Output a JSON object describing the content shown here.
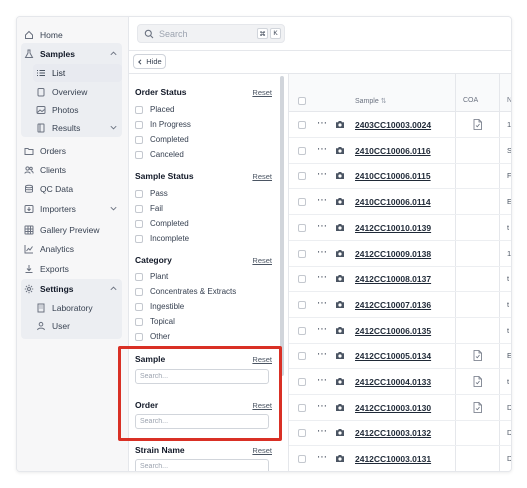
{
  "sidebar": {
    "items": [
      {
        "label": "Home",
        "icon": "home-icon"
      },
      {
        "label": "Samples",
        "icon": "flask-icon"
      },
      {
        "label": "List",
        "icon": "list-icon"
      },
      {
        "label": "Overview",
        "icon": "clipboard-icon"
      },
      {
        "label": "Photos",
        "icon": "image-icon"
      },
      {
        "label": "Results",
        "icon": "document-icon"
      },
      {
        "label": "Orders",
        "icon": "folder-icon"
      },
      {
        "label": "Clients",
        "icon": "users-icon"
      },
      {
        "label": "QC Data",
        "icon": "database-icon"
      },
      {
        "label": "Importers",
        "icon": "import-icon"
      },
      {
        "label": "Gallery Preview",
        "icon": "gallery-icon"
      },
      {
        "label": "Analytics",
        "icon": "chart-icon"
      },
      {
        "label": "Exports",
        "icon": "download-icon"
      },
      {
        "label": "Settings",
        "icon": "gear-icon"
      },
      {
        "label": "Laboratory",
        "icon": "building-icon"
      },
      {
        "label": "User",
        "icon": "user-icon"
      }
    ]
  },
  "search": {
    "placeholder": "Search",
    "shortcut_mod": "⌘",
    "shortcut_key": "K"
  },
  "hide_button": {
    "label": "Hide"
  },
  "filters": {
    "reset_label": "Reset",
    "order_status": {
      "title": "Order Status",
      "options": [
        "Placed",
        "In Progress",
        "Completed",
        "Canceled"
      ]
    },
    "sample_status": {
      "title": "Sample Status",
      "options": [
        "Pass",
        "Fail",
        "Completed",
        "Incomplete"
      ]
    },
    "category": {
      "title": "Category",
      "options": [
        "Plant",
        "Concentrates & Extracts",
        "Ingestible",
        "Topical",
        "Other"
      ]
    },
    "sample": {
      "title": "Sample",
      "placeholder": "Search..."
    },
    "order": {
      "title": "Order",
      "placeholder": "Search..."
    },
    "strain_name": {
      "title": "Strain Name",
      "placeholder": "Search..."
    }
  },
  "table": {
    "headers": {
      "sample": "Sample",
      "coa": "COA",
      "next": "N"
    },
    "rows": [
      {
        "sample": "2403CC10003.0024",
        "coa": true,
        "trunc": "1"
      },
      {
        "sample": "2410CC10006.0116",
        "coa": false,
        "trunc": "S"
      },
      {
        "sample": "2410CC10006.0115",
        "coa": false,
        "trunc": "F"
      },
      {
        "sample": "2410CC10006.0114",
        "coa": false,
        "trunc": "E"
      },
      {
        "sample": "2412CC10010.0139",
        "coa": false,
        "trunc": "t"
      },
      {
        "sample": "2412CC10009.0138",
        "coa": false,
        "trunc": "1"
      },
      {
        "sample": "2412CC10008.0137",
        "coa": false,
        "trunc": "t"
      },
      {
        "sample": "2412CC10007.0136",
        "coa": false,
        "trunc": "t"
      },
      {
        "sample": "2412CC10006.0135",
        "coa": false,
        "trunc": "t"
      },
      {
        "sample": "2412CC10005.0134",
        "coa": true,
        "trunc": "E"
      },
      {
        "sample": "2412CC10004.0133",
        "coa": true,
        "trunc": "t"
      },
      {
        "sample": "2412CC10003.0130",
        "coa": true,
        "trunc": "D"
      },
      {
        "sample": "2412CC10003.0132",
        "coa": false,
        "trunc": "D"
      },
      {
        "sample": "2412CC10003.0131",
        "coa": false,
        "trunc": "D"
      }
    ]
  },
  "colors": {
    "highlight": "#d93025",
    "sidebar_bg": "#f7f7f8",
    "active_bg": "#e8eaf0"
  }
}
